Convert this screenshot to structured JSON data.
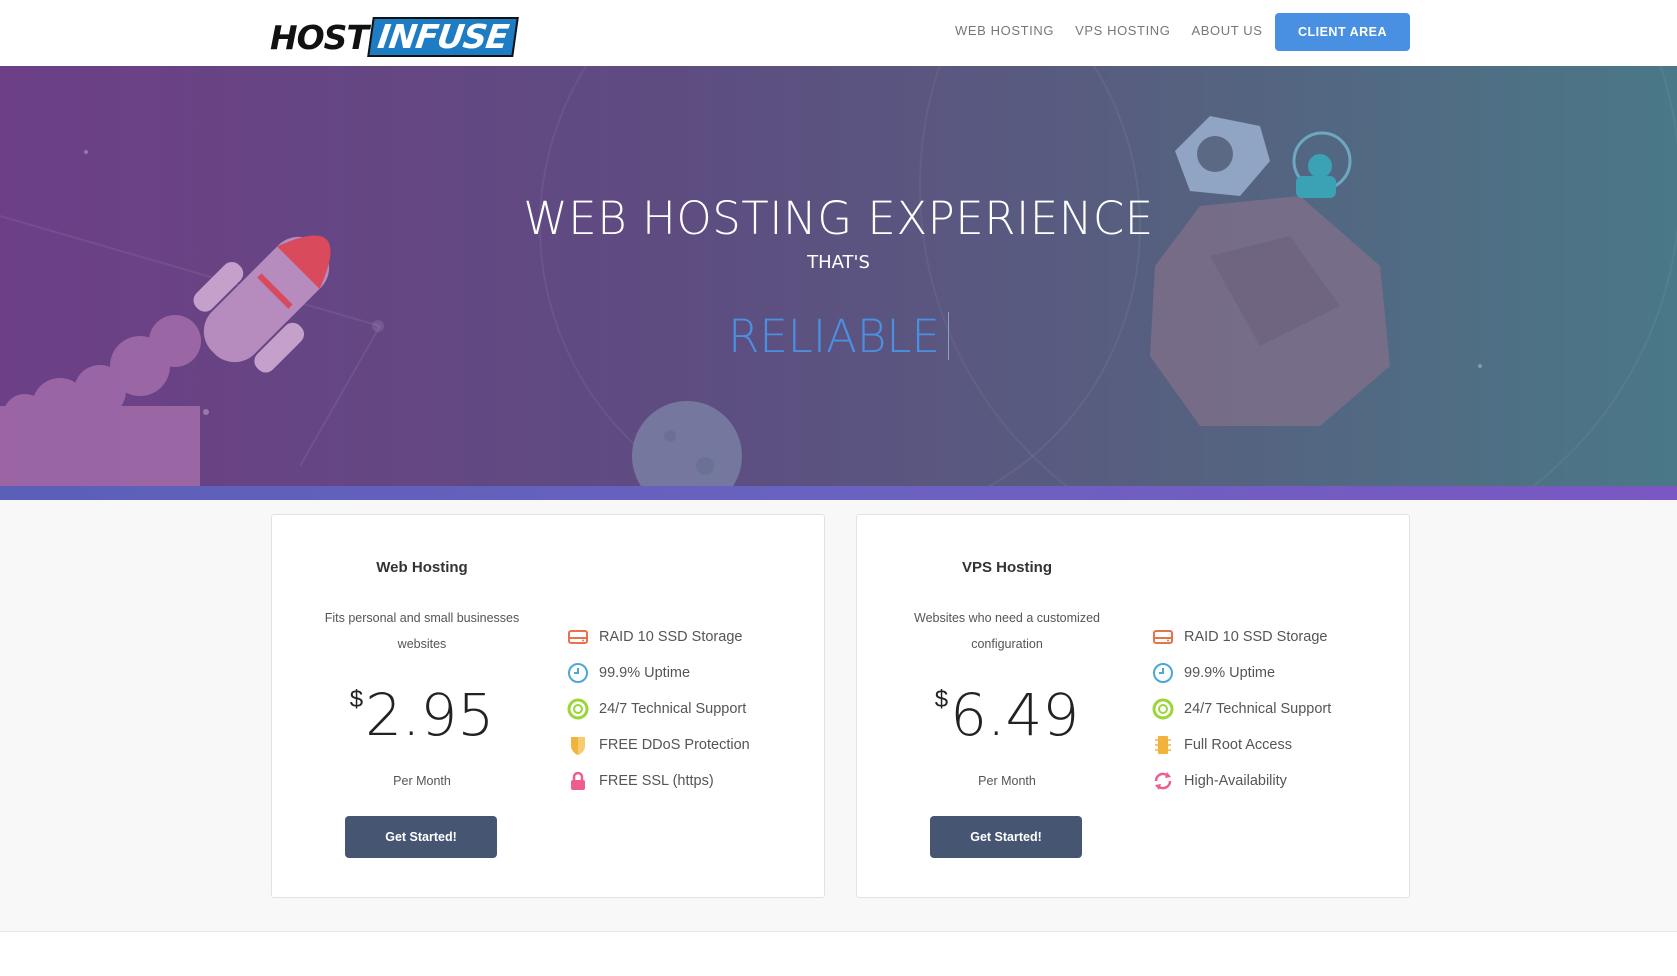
{
  "brand": {
    "part1": "HOST",
    "part2": "INFUSE"
  },
  "nav": {
    "items": [
      "WEB HOSTING",
      "VPS HOSTING",
      "ABOUT US"
    ],
    "client_button": "CLIENT AREA"
  },
  "hero": {
    "title": "WEB HOSTING EXPERIENCE",
    "subtitle": "THAT'S",
    "rotating_word": "RELIABLE"
  },
  "plans": [
    {
      "name": "Web Hosting",
      "description": "Fits personal and small businesses websites",
      "currency": "$",
      "price": "2.95",
      "period": "Per Month",
      "button": "Get Started!",
      "features": [
        {
          "label": "RAID 10 SSD Storage",
          "icon": "hdd-icon",
          "color": "#e8734a"
        },
        {
          "label": "99.9% Uptime",
          "icon": "clock-icon",
          "color": "#4aa8d8"
        },
        {
          "label": "24/7 Technical Support",
          "icon": "lifebuoy-icon",
          "color": "#9bd53a"
        },
        {
          "label": "FREE DDoS Protection",
          "icon": "shield-icon",
          "color": "#f2b33d"
        },
        {
          "label": "FREE SSL (https)",
          "icon": "lock-icon",
          "color": "#ef5d8e"
        }
      ]
    },
    {
      "name": "VPS Hosting",
      "description": "Websites who need a customized configuration",
      "currency": "$",
      "price": "6.49",
      "period": "Per Month",
      "button": "Get Started!",
      "features": [
        {
          "label": "RAID 10 SSD Storage",
          "icon": "hdd-icon",
          "color": "#e8734a"
        },
        {
          "label": "99.9% Uptime",
          "icon": "clock-icon",
          "color": "#4aa8d8"
        },
        {
          "label": "24/7 Technical Support",
          "icon": "lifebuoy-icon",
          "color": "#9bd53a"
        },
        {
          "label": "Full Root Access",
          "icon": "chip-icon",
          "color": "#f2b33d"
        },
        {
          "label": "High-Availability",
          "icon": "refresh-icon",
          "color": "#ef5d8e"
        }
      ]
    }
  ]
}
